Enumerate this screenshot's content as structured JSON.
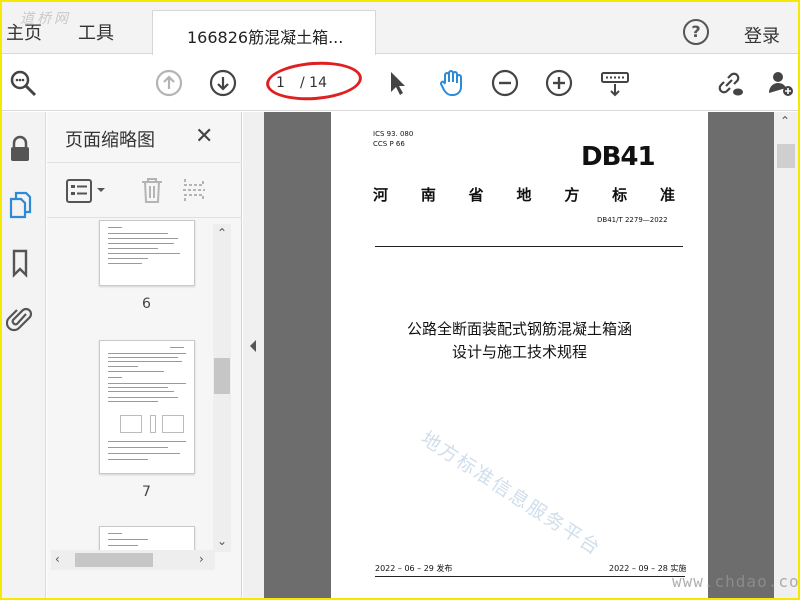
{
  "tabs": {
    "home": "主页",
    "tools": "工具",
    "document": "166826筋混凝土箱...",
    "help": "?",
    "login": "登录",
    "watermark_logo": "道桥网"
  },
  "toolbar": {
    "current_page": "1",
    "total_pages": "/ 14",
    "icons": [
      "zoom-search-icon",
      "prev-page-icon",
      "next-page-icon",
      "select-pointer-icon",
      "hand-tool-icon",
      "zoom-out-icon",
      "zoom-in-icon",
      "keyboard-icon",
      "share-link-icon",
      "add-user-icon"
    ],
    "accent_color": "#2d8ad6",
    "highlight_color": "#e02020"
  },
  "rail": {
    "icons": [
      "lock-icon",
      "pages-icon",
      "bookmark-icon",
      "attachment-icon"
    ]
  },
  "thumbnail_panel": {
    "title": "页面缩略图",
    "close": "✕",
    "pages": [
      {
        "number": "6"
      },
      {
        "number": "7"
      },
      {
        "number": ""
      }
    ]
  },
  "document": {
    "ics_code": "ICS  93. 080",
    "ccs_code": "CCS  P  66",
    "logo": "DB41",
    "province_chars": [
      "河",
      "南",
      "省",
      "地",
      "方",
      "标",
      "准"
    ],
    "standard_no": "DB41/T  2279—2022",
    "title_line1": "公路全断面装配式钢筋混凝土箱涵",
    "title_line2": "设计与施工技术规程",
    "watermark": "地方标准信息服务平台",
    "publish_date": "2022 – 06 – 29 发布",
    "implement_date": "2022 – 09 – 28 实施"
  },
  "site_watermark": "www.chdao.com"
}
